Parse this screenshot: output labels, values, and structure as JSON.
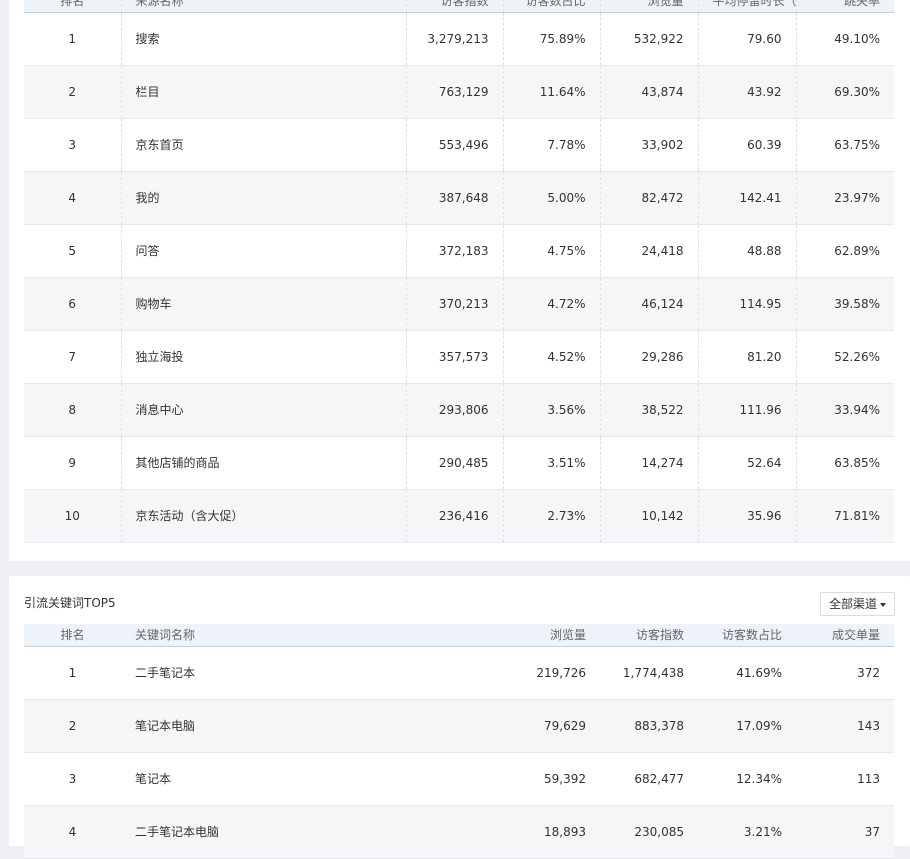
{
  "traffic_sources": {
    "columns": [
      "排名",
      "来源名称",
      "访客指数",
      "访客数占比",
      "浏览量",
      "平均停留时长（秒）",
      "跳失率"
    ],
    "rows": [
      {
        "rank": "1",
        "name": "搜索",
        "visitor_index": "3,279,213",
        "visitor_share": "75.89%",
        "pageviews": "532,922",
        "avg_stay": "79.60",
        "bounce": "49.10%"
      },
      {
        "rank": "2",
        "name": "栏目",
        "visitor_index": "763,129",
        "visitor_share": "11.64%",
        "pageviews": "43,874",
        "avg_stay": "43.92",
        "bounce": "69.30%"
      },
      {
        "rank": "3",
        "name": "京东首页",
        "visitor_index": "553,496",
        "visitor_share": "7.78%",
        "pageviews": "33,902",
        "avg_stay": "60.39",
        "bounce": "63.75%"
      },
      {
        "rank": "4",
        "name": "我的",
        "visitor_index": "387,648",
        "visitor_share": "5.00%",
        "pageviews": "82,472",
        "avg_stay": "142.41",
        "bounce": "23.97%"
      },
      {
        "rank": "5",
        "name": "问答",
        "visitor_index": "372,183",
        "visitor_share": "4.75%",
        "pageviews": "24,418",
        "avg_stay": "48.88",
        "bounce": "62.89%"
      },
      {
        "rank": "6",
        "name": "购物车",
        "visitor_index": "370,213",
        "visitor_share": "4.72%",
        "pageviews": "46,124",
        "avg_stay": "114.95",
        "bounce": "39.58%"
      },
      {
        "rank": "7",
        "name": "独立海投",
        "visitor_index": "357,573",
        "visitor_share": "4.52%",
        "pageviews": "29,286",
        "avg_stay": "81.20",
        "bounce": "52.26%"
      },
      {
        "rank": "8",
        "name": "消息中心",
        "visitor_index": "293,806",
        "visitor_share": "3.56%",
        "pageviews": "38,522",
        "avg_stay": "111.96",
        "bounce": "33.94%"
      },
      {
        "rank": "9",
        "name": "其他店铺的商品",
        "visitor_index": "290,485",
        "visitor_share": "3.51%",
        "pageviews": "14,274",
        "avg_stay": "52.64",
        "bounce": "63.85%"
      },
      {
        "rank": "10",
        "name": "京东活动（含大促）",
        "visitor_index": "236,416",
        "visitor_share": "2.73%",
        "pageviews": "10,142",
        "avg_stay": "35.96",
        "bounce": "71.81%"
      }
    ]
  },
  "keywords": {
    "title": "引流关键词TOP5",
    "channel_dropdown": "全部渠道",
    "columns": [
      "排名",
      "关键词名称",
      "浏览量",
      "访客指数",
      "访客数占比",
      "成交单量"
    ],
    "rows": [
      {
        "rank": "1",
        "name": "二手笔记本",
        "pageviews": "219,726",
        "visitor_index": "1,774,438",
        "visitor_share": "41.69%",
        "orders": "372"
      },
      {
        "rank": "2",
        "name": "笔记本电脑",
        "pageviews": "79,629",
        "visitor_index": "883,378",
        "visitor_share": "17.09%",
        "orders": "143"
      },
      {
        "rank": "3",
        "name": "笔记本",
        "pageviews": "59,392",
        "visitor_index": "682,477",
        "visitor_share": "12.34%",
        "orders": "113"
      },
      {
        "rank": "4",
        "name": "二手笔记本电脑",
        "pageviews": "18,893",
        "visitor_index": "230,085",
        "visitor_share": "3.21%",
        "orders": "37"
      }
    ]
  }
}
